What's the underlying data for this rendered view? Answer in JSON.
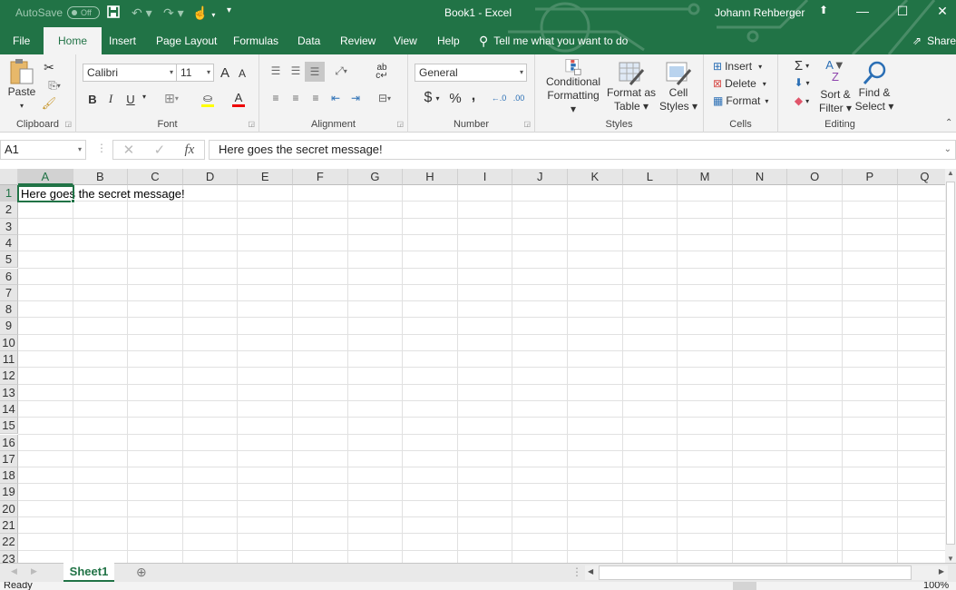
{
  "titlebar": {
    "autosave_label": "AutoSave",
    "autosave_state": "Off",
    "title": "Book1  -  Excel",
    "user": "Johann Rehberger"
  },
  "tabs": [
    {
      "label": "File",
      "active": false
    },
    {
      "label": "Home",
      "active": true
    },
    {
      "label": "Insert",
      "active": false
    },
    {
      "label": "Page Layout",
      "active": false
    },
    {
      "label": "Formulas",
      "active": false
    },
    {
      "label": "Data",
      "active": false
    },
    {
      "label": "Review",
      "active": false
    },
    {
      "label": "View",
      "active": false
    },
    {
      "label": "Help",
      "active": false
    }
  ],
  "tell_me": "Tell me what you want to do",
  "share_label": "Share",
  "ribbon": {
    "clipboard": {
      "paste": "Paste",
      "label": "Clipboard"
    },
    "font": {
      "family": "Calibri",
      "size": "11",
      "label": "Font",
      "bold": "B",
      "italic": "I",
      "underline": "U",
      "grow": "A",
      "shrink": "A"
    },
    "alignment": {
      "label": "Alignment"
    },
    "number": {
      "format": "General",
      "label": "Number",
      "currency": "$",
      "percent": "%",
      "comma": ","
    },
    "styles": {
      "conditional": [
        "Conditional",
        "Formatting"
      ],
      "format_table": [
        "Format as",
        "Table"
      ],
      "cell_styles": [
        "Cell",
        "Styles"
      ],
      "label": "Styles"
    },
    "cells": {
      "insert": "Insert",
      "delete": "Delete",
      "format": "Format",
      "label": "Cells"
    },
    "editing": {
      "sort": [
        "Sort &",
        "Filter"
      ],
      "find": [
        "Find &",
        "Select"
      ],
      "label": "Editing"
    }
  },
  "formula_bar": {
    "name_box": "A1",
    "content": "Here goes the secret message!"
  },
  "grid": {
    "columns": [
      "A",
      "B",
      "C",
      "D",
      "E",
      "F",
      "G",
      "H",
      "I",
      "J",
      "K",
      "L",
      "M",
      "N",
      "O",
      "P",
      "Q"
    ],
    "rows": [
      "1",
      "2",
      "3",
      "4",
      "5",
      "6",
      "7",
      "8",
      "9",
      "10",
      "11",
      "12",
      "13",
      "14",
      "15",
      "16",
      "17",
      "18",
      "19",
      "20",
      "21",
      "22",
      "23"
    ],
    "selected_cell": "A1",
    "cells": {
      "A1": "Here goes the secret message!"
    }
  },
  "sheets": [
    {
      "name": "Sheet1",
      "active": true
    }
  ],
  "status": {
    "text": "Ready",
    "zoom": "100%"
  }
}
